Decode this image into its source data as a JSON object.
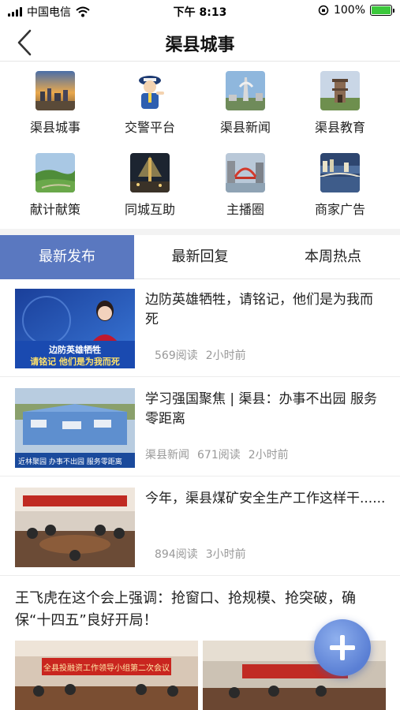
{
  "status_bar": {
    "carrier": "中国电信",
    "time": "下午 8:13",
    "battery_percent": "100%",
    "battery_level": 1.0,
    "icons": [
      "signal-icon",
      "wifi-icon",
      "orientation-lock-icon",
      "battery-icon"
    ]
  },
  "nav": {
    "title": "渠县城事",
    "back_icon": "chevron-left-icon"
  },
  "grid": [
    {
      "label": "渠县城事",
      "icon": "city-sunset-icon"
    },
    {
      "label": "交警平台",
      "icon": "traffic-police-icon"
    },
    {
      "label": "渠县新闻",
      "icon": "monument-icon"
    },
    {
      "label": "渠县教育",
      "icon": "ancient-tower-icon"
    },
    {
      "label": "献计献策",
      "icon": "green-field-icon"
    },
    {
      "label": "同城互助",
      "icon": "light-tower-icon"
    },
    {
      "label": "主播圈",
      "icon": "red-bridge-icon"
    },
    {
      "label": "商家广告",
      "icon": "river-city-icon"
    }
  ],
  "tabs": [
    {
      "label": "最新发布",
      "active": true
    },
    {
      "label": "最新回复",
      "active": false
    },
    {
      "label": "本周热点",
      "active": false
    }
  ],
  "news": [
    {
      "title": "边防英雄牺牲，请铭记，他们是为我而死",
      "source": "",
      "reads": "569阅读",
      "time": "2小时前",
      "thumb_caption_1": "边防英雄牺牲",
      "thumb_caption_2": "请铭记 他们是为我而死"
    },
    {
      "title": "学习强国聚焦 | 渠县：办事不出园 服务零距离",
      "source": "渠县新闻",
      "reads": "671阅读",
      "time": "2小时前",
      "thumb_caption_1": "近林聚园 办事不出园 服务零距离"
    },
    {
      "title": "今年，渠县煤矿安全生产工作这样干......",
      "source": "",
      "reads": "894阅读",
      "time": "3小时前"
    }
  ],
  "article": {
    "title": "王飞虎在这个会上强调：抢窗口、抢规模、抢突破，确保“十四五”良好开局！",
    "banner_text": "全县投融资工作领导小组第二次会议"
  },
  "fab_icon": "plus-icon",
  "colors": {
    "accent": "#5a78c0",
    "meta_text": "#999999",
    "fab": "#6a8ee0"
  }
}
